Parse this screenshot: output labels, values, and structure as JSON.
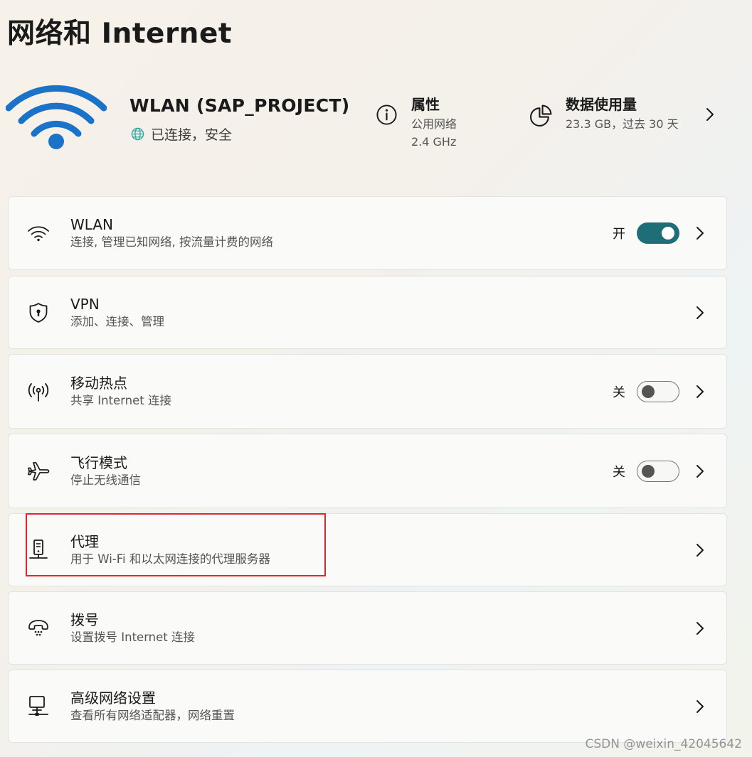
{
  "page": {
    "title": "网络和 Internet"
  },
  "connection": {
    "name": "WLAN (SAP_PROJECT)",
    "status": "已连接，安全",
    "icon": "wifi-full-icon"
  },
  "properties": {
    "title": "属性",
    "network_type": "公用网络",
    "band": "2.4 GHz",
    "icon": "info-icon"
  },
  "data_usage": {
    "title": "数据使用量",
    "value": "23.3 GB，过去 30 天",
    "icon": "pie-chart-icon"
  },
  "settings": [
    {
      "id": "wlan",
      "title": "WLAN",
      "subtitle": "连接, 管理已知网络, 按流量计费的网络",
      "icon": "wifi-icon",
      "toggle": true,
      "state": "开",
      "on": true
    },
    {
      "id": "vpn",
      "title": "VPN",
      "subtitle": "添加、连接、管理",
      "icon": "shield-icon",
      "toggle": false
    },
    {
      "id": "hotspot",
      "title": "移动热点",
      "subtitle": "共享 Internet 连接",
      "icon": "hotspot-icon",
      "toggle": true,
      "state": "关",
      "on": false
    },
    {
      "id": "airplane",
      "title": "飞行模式",
      "subtitle": "停止无线通信",
      "icon": "airplane-icon",
      "toggle": true,
      "state": "关",
      "on": false
    },
    {
      "id": "proxy",
      "title": "代理",
      "subtitle": "用于 Wi-Fi 和以太网连接的代理服务器",
      "icon": "proxy-server-icon",
      "toggle": false
    },
    {
      "id": "dialup",
      "title": "拨号",
      "subtitle": "设置拨号 Internet 连接",
      "icon": "phone-icon",
      "toggle": false
    },
    {
      "id": "advanced",
      "title": "高级网络设置",
      "subtitle": "查看所有网络适配器，网络重置",
      "icon": "network-computer-icon",
      "toggle": false
    }
  ],
  "colors": {
    "accent": "#1e6e77",
    "wifi_blue": "#1a73c8",
    "highlight": "#e3242b"
  },
  "watermark": "CSDN @weixin_42045642"
}
